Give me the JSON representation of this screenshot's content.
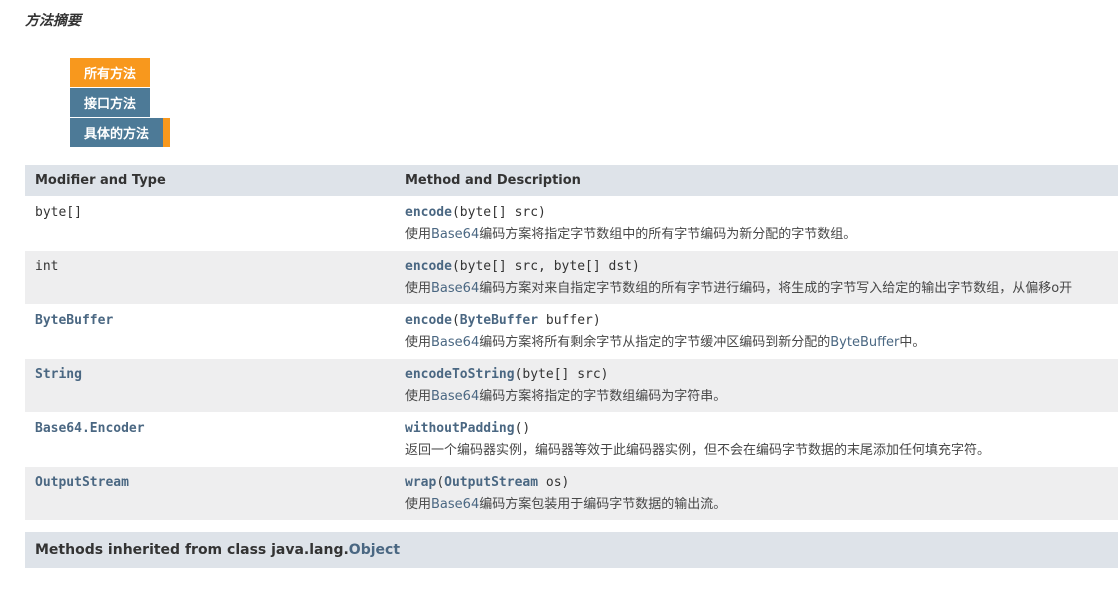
{
  "section_title": "方法摘要",
  "tabs": {
    "all": "所有方法",
    "interface": "接口方法",
    "concrete": "具体的方法"
  },
  "headers": {
    "col1": "Modifier and Type",
    "col2": "Method and Description"
  },
  "methods": [
    {
      "type_plain": "byte[]",
      "method": "encode",
      "sig": "(byte[] src)",
      "desc_pre": "使用",
      "desc_link": "Base64",
      "desc_post": "编码方案将指定字节数组中的所有字节编码为新分配的字节数组。"
    },
    {
      "type_plain": "int",
      "method": "encode",
      "sig": "(byte[] src, byte[] dst)",
      "desc_pre": "使用",
      "desc_link": "Base64",
      "desc_post": "编码方案对来自指定字节数组的所有字节进行编码，将生成的字节写入给定的输出字节数组，从偏移o开"
    },
    {
      "type_link": "ByteBuffer",
      "method": "encode",
      "sig_pre": "(",
      "sig_link": "ByteBuffer",
      "sig_post": " buffer)",
      "desc_pre": "使用",
      "desc_link": "Base64",
      "desc_mid": "编码方案将所有剩余字节从指定的字节缓冲区编码到新分配的",
      "desc_link2": "ByteBuffer",
      "desc_post": "中。"
    },
    {
      "type_link": "String",
      "method": "encodeToString",
      "sig": "(byte[] src)",
      "desc_pre": "使用",
      "desc_link": "Base64",
      "desc_post": "编码方案将指定的字节数组编码为字符串。"
    },
    {
      "type_link": "Base64.Encoder",
      "method": "withoutPadding",
      "sig": "()",
      "desc_plain": "返回一个编码器实例，编码器等效于此编码器实例，但不会在编码字节数据的末尾添加任何填充字符。"
    },
    {
      "type_link": "OutputStream",
      "method": "wrap",
      "sig_pre": "(",
      "sig_link": "OutputStream",
      "sig_post": " os)",
      "desc_pre": "使用",
      "desc_link": "Base64",
      "desc_post": "编码方案包装用于编码字节数据的输出流。"
    }
  ],
  "inherited": {
    "prefix": "Methods inherited from class java.lang.",
    "link": "Object"
  }
}
